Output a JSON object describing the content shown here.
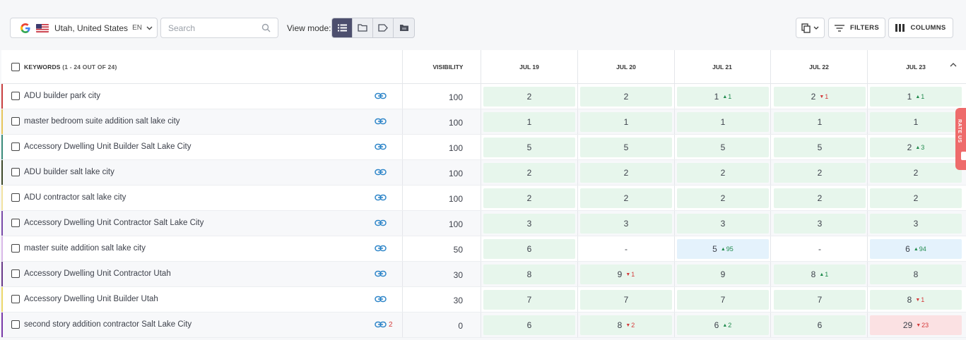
{
  "toolbar": {
    "location": "Utah, United States",
    "language": "EN",
    "search_placeholder": "Search",
    "view_mode_label": "View mode:",
    "view_modes": [
      "list",
      "folder",
      "tag",
      "group"
    ],
    "active_view_mode": "list",
    "filters_label": "FILTERS",
    "columns_label": "COLUMNS"
  },
  "table": {
    "keywords_header": "KEYWORDS",
    "keywords_count": "(1 - 24 OUT OF 24)",
    "visibility_header": "VISIBILITY",
    "dates": [
      "JUL 19",
      "JUL 20",
      "JUL 21",
      "JUL 22",
      "JUL 23"
    ],
    "rows": [
      {
        "keyword": "ADU builder park city",
        "bar": "#c94040",
        "link_count": "",
        "visibility": "100",
        "cells": [
          {
            "v": "2",
            "c": "",
            "d": "",
            "s": "green"
          },
          {
            "v": "2",
            "c": "",
            "d": "",
            "s": "green"
          },
          {
            "v": "1",
            "c": "1",
            "d": "up",
            "s": "green"
          },
          {
            "v": "2",
            "c": "1",
            "d": "down",
            "s": "green"
          },
          {
            "v": "1",
            "c": "1",
            "d": "up",
            "s": "green"
          }
        ]
      },
      {
        "keyword": "master bedroom suite addition salt lake city",
        "bar": "#e6c55a",
        "link_count": "",
        "visibility": "100",
        "cells": [
          {
            "v": "1",
            "c": "",
            "d": "",
            "s": "green"
          },
          {
            "v": "1",
            "c": "",
            "d": "",
            "s": "green"
          },
          {
            "v": "1",
            "c": "",
            "d": "",
            "s": "green"
          },
          {
            "v": "1",
            "c": "",
            "d": "",
            "s": "green"
          },
          {
            "v": "1",
            "c": "",
            "d": "",
            "s": "green"
          }
        ]
      },
      {
        "keyword": "Accessory Dwelling Unit Builder Salt Lake City",
        "bar": "#3c8c7a",
        "link_count": "",
        "visibility": "100",
        "cells": [
          {
            "v": "5",
            "c": "",
            "d": "",
            "s": "green"
          },
          {
            "v": "5",
            "c": "",
            "d": "",
            "s": "green"
          },
          {
            "v": "5",
            "c": "",
            "d": "",
            "s": "green"
          },
          {
            "v": "5",
            "c": "",
            "d": "",
            "s": "green"
          },
          {
            "v": "2",
            "c": "3",
            "d": "up",
            "s": "green"
          }
        ]
      },
      {
        "keyword": "ADU builder salt lake city",
        "bar": "#3f4a2a",
        "link_count": "",
        "visibility": "100",
        "cells": [
          {
            "v": "2",
            "c": "",
            "d": "",
            "s": "green"
          },
          {
            "v": "2",
            "c": "",
            "d": "",
            "s": "green"
          },
          {
            "v": "2",
            "c": "",
            "d": "",
            "s": "green"
          },
          {
            "v": "2",
            "c": "",
            "d": "",
            "s": "green"
          },
          {
            "v": "2",
            "c": "",
            "d": "",
            "s": "green"
          }
        ]
      },
      {
        "keyword": "ADU contractor salt lake city",
        "bar": "#f2e2a0",
        "link_count": "",
        "visibility": "100",
        "cells": [
          {
            "v": "2",
            "c": "",
            "d": "",
            "s": "green"
          },
          {
            "v": "2",
            "c": "",
            "d": "",
            "s": "green"
          },
          {
            "v": "2",
            "c": "",
            "d": "",
            "s": "green"
          },
          {
            "v": "2",
            "c": "",
            "d": "",
            "s": "green"
          },
          {
            "v": "2",
            "c": "",
            "d": "",
            "s": "green"
          }
        ]
      },
      {
        "keyword": "Accessory Dwelling Unit Contractor Salt Lake City",
        "bar": "#7a4aa8",
        "link_count": "",
        "visibility": "100",
        "cells": [
          {
            "v": "3",
            "c": "",
            "d": "",
            "s": "green"
          },
          {
            "v": "3",
            "c": "",
            "d": "",
            "s": "green"
          },
          {
            "v": "3",
            "c": "",
            "d": "",
            "s": "green"
          },
          {
            "v": "3",
            "c": "",
            "d": "",
            "s": "green"
          },
          {
            "v": "3",
            "c": "",
            "d": "",
            "s": "green"
          }
        ]
      },
      {
        "keyword": "master suite addition salt lake city",
        "bar": "#d9b8e8",
        "link_count": "",
        "visibility": "50",
        "cells": [
          {
            "v": "6",
            "c": "",
            "d": "",
            "s": "green"
          },
          {
            "v": "-",
            "c": "",
            "d": "",
            "s": "none"
          },
          {
            "v": "5",
            "c": "95",
            "d": "up",
            "s": "blue"
          },
          {
            "v": "-",
            "c": "",
            "d": "",
            "s": "none"
          },
          {
            "v": "6",
            "c": "94",
            "d": "up",
            "s": "blue"
          }
        ]
      },
      {
        "keyword": "Accessory Dwelling Unit Contractor Utah",
        "bar": "#6a3a8a",
        "link_count": "",
        "visibility": "30",
        "cells": [
          {
            "v": "8",
            "c": "",
            "d": "",
            "s": "green"
          },
          {
            "v": "9",
            "c": "1",
            "d": "down",
            "s": "green"
          },
          {
            "v": "9",
            "c": "",
            "d": "",
            "s": "green"
          },
          {
            "v": "8",
            "c": "1",
            "d": "up",
            "s": "green"
          },
          {
            "v": "8",
            "c": "",
            "d": "",
            "s": "green"
          }
        ]
      },
      {
        "keyword": "Accessory Dwelling Unit Builder Utah",
        "bar": "#ecd86a",
        "link_count": "",
        "visibility": "30",
        "cells": [
          {
            "v": "7",
            "c": "",
            "d": "",
            "s": "green"
          },
          {
            "v": "7",
            "c": "",
            "d": "",
            "s": "green"
          },
          {
            "v": "7",
            "c": "",
            "d": "",
            "s": "green"
          },
          {
            "v": "7",
            "c": "",
            "d": "",
            "s": "green"
          },
          {
            "v": "8",
            "c": "1",
            "d": "down",
            "s": "green"
          }
        ]
      },
      {
        "keyword": "second story addition contractor Salt Lake City",
        "bar": "#7a3aa8",
        "link_count": "2",
        "visibility": "0",
        "cells": [
          {
            "v": "6",
            "c": "",
            "d": "",
            "s": "green"
          },
          {
            "v": "8",
            "c": "2",
            "d": "down",
            "s": "green"
          },
          {
            "v": "6",
            "c": "2",
            "d": "up",
            "s": "green"
          },
          {
            "v": "6",
            "c": "",
            "d": "",
            "s": "green"
          },
          {
            "v": "29",
            "c": "23",
            "d": "down",
            "s": "red"
          }
        ]
      }
    ]
  },
  "rate_us": "RATE US"
}
